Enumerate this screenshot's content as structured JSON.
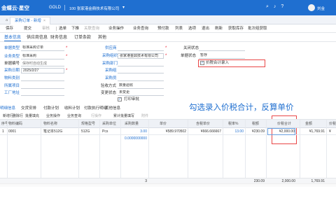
{
  "app": {
    "brand": "金蝶云·星空",
    "edition": "GOLD",
    "org": "100  张家港金鼎技术有限公司",
    "user": "刘金"
  },
  "tabs": [
    {
      "label": "采购订单 - 新增",
      "close": "×"
    }
  ],
  "toolbar": [
    "保存",
    "提交",
    "审核",
    "选单",
    "下推",
    "关联查询",
    "业务操作",
    "业务查询",
    "预付款",
    "列表",
    "选项",
    "退出",
    "刷新",
    "获取库存",
    "批次组获取"
  ],
  "toolbar_dim": [
    "审核",
    "关联查询"
  ],
  "subtabs": [
    "基本信息",
    "供应商信息",
    "财务信息",
    "订单条款",
    "其他"
  ],
  "form": {
    "doc_type": {
      "label": "单据类型",
      "value": "标准采购订单"
    },
    "biz_type": {
      "label": "业务类型",
      "value": "标准采购"
    },
    "doc_no": {
      "label": "单据编号",
      "placeholder": "保存时自动生成"
    },
    "po_date": {
      "label": "采购日期",
      "value": "2025/2/27"
    },
    "material_req": {
      "label": "物料类别",
      "value": ""
    },
    "project": {
      "label": "所属项目",
      "value": ""
    },
    "factory": {
      "label": "工厂地址",
      "value": ""
    },
    "supplier": {
      "label": "供应商",
      "value": ""
    },
    "purch_org": {
      "label": "采购组织",
      "value": "张家港金鼎技术有限公司"
    },
    "purch_dept": {
      "label": "采购部门",
      "value": ""
    },
    "purch_group": {
      "label": "采购组",
      "value": ""
    },
    "buyer": {
      "label": "采购员",
      "value": ""
    },
    "valid_method": {
      "label": "验收方式",
      "value": "数量验收"
    },
    "change_state": {
      "label": "变更状态",
      "value": "未变更"
    },
    "print_label": "打印审批",
    "close_state": {
      "label": "关闭状态",
      "value": ""
    },
    "doc_state": {
      "label": "单据状态",
      "value": "暂存"
    },
    "tax_price_label": "价税合计录入"
  },
  "annotation": "勾选录入价税合计，反算单价",
  "entry_tabs": [
    "明细信息",
    "交货安排",
    "付款计划",
    "收料计划",
    "付款执行明细",
    "其他信息"
  ],
  "entry_toolbar": [
    "新增行",
    "删除行",
    "批量填充",
    "业务操作",
    "业务查询",
    "行操作",
    "累计批量填写",
    "附件"
  ],
  "entry_toolbar_dim": [
    "行操作",
    "附件"
  ],
  "grid": {
    "headers": [
      "序号",
      "物料编码",
      "物料名称",
      "规格型号",
      "采购单位",
      "采购数量",
      "单价",
      "含税单价",
      "税率%",
      "税额",
      "价税合计",
      "金额",
      "价税"
    ],
    "rows": [
      [
        "1",
        "0001",
        "笔记本512G",
        "512G",
        "Pcs",
        "3.00",
        "¥589.970502",
        "¥666.666667",
        "13.00",
        "¥230.09",
        "¥2,000.00",
        "¥1,769.91",
        "¥"
      ],
      [
        "",
        "",
        "",
        "",
        "",
        "0.0000000000",
        "",
        "",
        "",
        "",
        "",
        "",
        ""
      ]
    ],
    "totals": {
      "qty": "3",
      "tax": "230.09",
      "amount": "2,000.00",
      "amount2": "1,769.91"
    }
  }
}
